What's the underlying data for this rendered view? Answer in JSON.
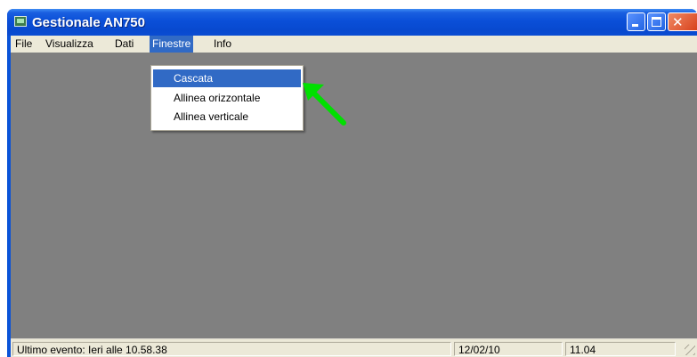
{
  "window": {
    "title": "Gestionale AN750",
    "icon": "app-window-icon",
    "controls": [
      "minimize",
      "maximize",
      "close"
    ]
  },
  "menubar": {
    "items": [
      "File",
      "Visualizza",
      "Dati",
      "Finestre",
      "Info"
    ],
    "active": "Finestre"
  },
  "finestre_menu": {
    "items": [
      "Cascata",
      "Allinea orizzontale",
      "Allinea verticale"
    ],
    "highlighted": "Cascata"
  },
  "annotation": {
    "icon": "green-arrow-icon",
    "color": "#00e000"
  },
  "statusbar": {
    "event": "Ultimo evento: Ieri alle 10.58.38",
    "date": "12/02/10",
    "time": "11.04"
  },
  "colors": {
    "titlebar": "#0a4fd8",
    "menu_highlight": "#316ac5",
    "client_area": "#808080",
    "chrome": "#ece9d8"
  }
}
